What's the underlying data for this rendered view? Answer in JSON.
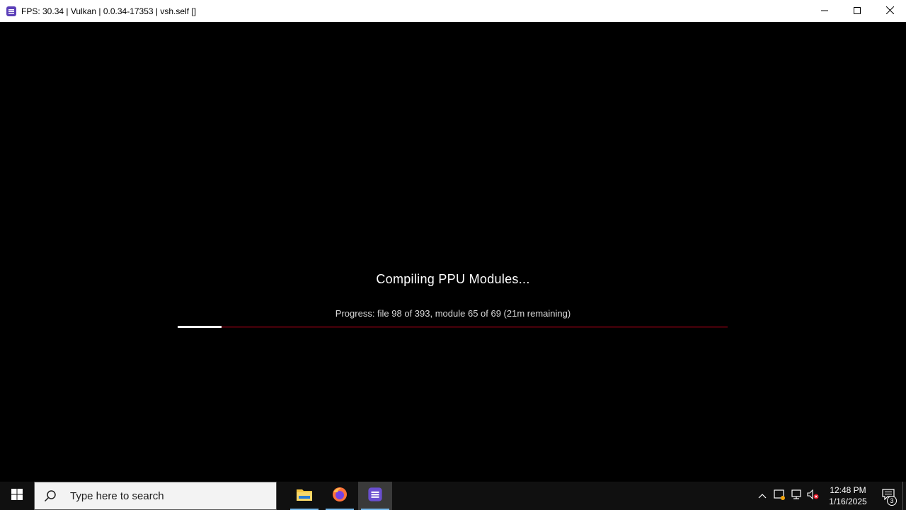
{
  "window": {
    "title": "FPS: 30.34 | Vulkan | 0.0.34-17353 | vsh.self []",
    "app_icon": "rpcs3-icon",
    "controls": [
      "minimize-icon",
      "maximize-icon",
      "close-icon"
    ]
  },
  "main": {
    "heading": "Compiling PPU Modules...",
    "progress_text": "Progress: file 98 of 393, module 65 of 69 (21m remaining)",
    "progress_fraction": 0.08,
    "colors": {
      "fill": "#ffffff",
      "track": "#3a0008"
    }
  },
  "taskbar": {
    "search": {
      "placeholder": "Type here to search",
      "icon": "search-icon"
    },
    "apps": [
      {
        "name": "file-explorer-icon",
        "active": false,
        "running": true
      },
      {
        "name": "firefox-icon",
        "active": false,
        "running": true
      },
      {
        "name": "rpcs3-icon",
        "active": true,
        "running": true
      }
    ],
    "tray": {
      "icons": [
        "chevron-up-icon",
        "security-icon",
        "network-icon",
        "volume-muted-icon"
      ],
      "time": "12:48 PM",
      "date": "1/16/2025",
      "notification_count": "3"
    }
  }
}
